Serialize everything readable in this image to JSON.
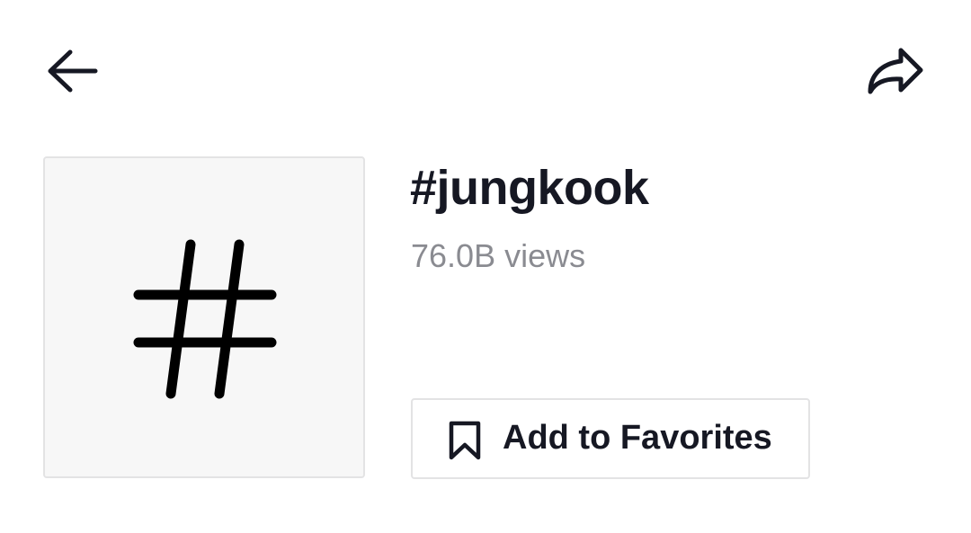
{
  "header": {
    "back_icon": "arrow-left-icon",
    "share_icon": "share-forward-icon"
  },
  "hashtag": {
    "cover_icon": "hashtag-icon",
    "title": "#jungkook",
    "views": "76.0B views"
  },
  "favorites_button": {
    "icon": "bookmark-icon",
    "label": "Add to Favorites"
  },
  "colors": {
    "text_primary": "#161823",
    "text_secondary": "#8a8b91",
    "border": "#e3e3e4",
    "cover_bg": "#f7f7f7"
  }
}
